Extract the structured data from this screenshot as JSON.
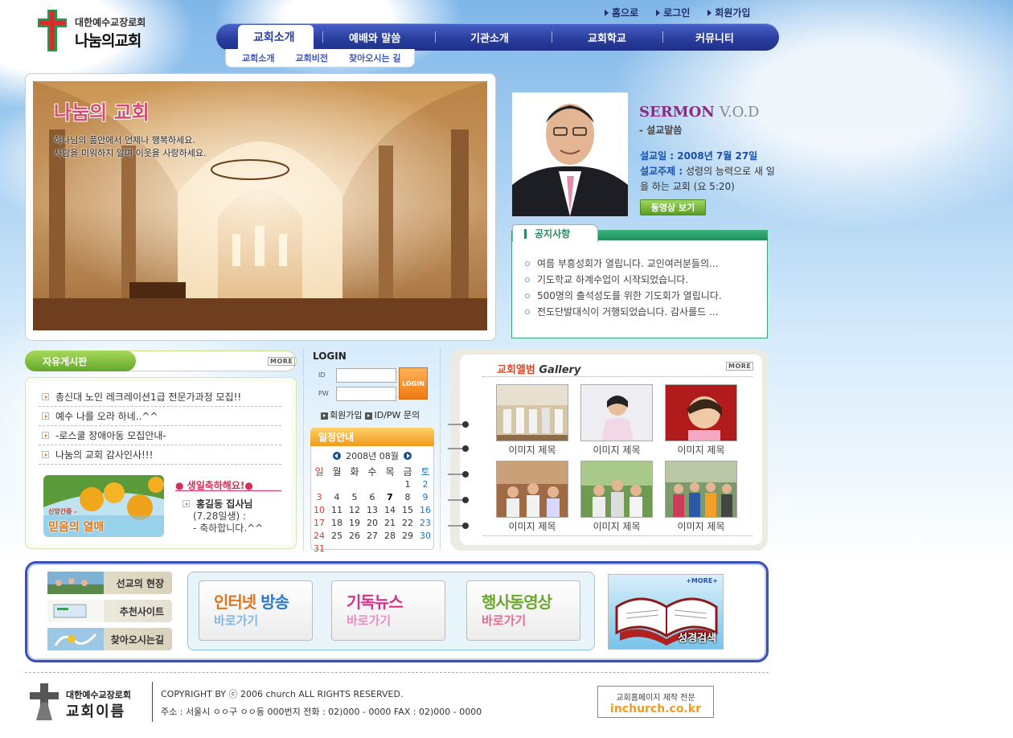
{
  "logo": {
    "org": "대한예수교장로회",
    "name": "나눔의교회"
  },
  "toplinks": [
    "홈으로",
    "로그인",
    "회원가입"
  ],
  "nav": {
    "items": [
      "교회소개",
      "예배와 말씀",
      "기관소개",
      "교회학교",
      "커뮤니티"
    ],
    "sub": [
      "교회소개",
      "교회비전",
      "찾아오시는 길"
    ]
  },
  "hero": {
    "title": "나눔의 교회",
    "line1": "하나님의 품안에서 언제나 행복하세요.",
    "line2": "사람을 미워하지 말며 이웃을 사랑하세요."
  },
  "sermon": {
    "title": "SERMON",
    "title2": "V.O.D",
    "subtitle": "- 설교말씀",
    "date_label": "설교일 :",
    "date": "2008년  7월  27일",
    "topic_label": "설교주제 :",
    "topic": "성령의 능력으로 새 일을 하는 교회 (요 5:20)",
    "button": "동영상 보기"
  },
  "notice": {
    "tab": "공지사항",
    "items": [
      "여름 부흥성회가 열립니다. 교인여러분들의...",
      "기도학교 하계수업이 시작되었습니다.",
      "500명의 출석성도를 위한 기도회가 열립니다.",
      "전도단발대식이 거행되었습니다. 감사를드 ..."
    ]
  },
  "board": {
    "title": "자유게시판",
    "more": "MORE",
    "items": [
      "총신대 노인 레크레이션1급 전문가과정 모집!!",
      "예수 나를 오라 하네..^^",
      "-로스쿨 장애아동 모집안내-",
      "나눔의 교회 감사인사!!!"
    ],
    "banner_small": "신앙간증 -",
    "banner_big": "믿음의 열매"
  },
  "birthday": {
    "title": "● 생일축하해요!●",
    "name": "홍길동 집사님",
    "date": "(7.28일생) :",
    "msg": "- 축하합니다.^^"
  },
  "login": {
    "title": "LOGIN",
    "id_label": "ID",
    "pw_label": "PW",
    "button": "LOGIN",
    "join": "회원가입",
    "find": "ID/PW 문의"
  },
  "calendar": {
    "title": "일정안내",
    "month": "2008년 08월",
    "dow": [
      "일",
      "월",
      "화",
      "수",
      "목",
      "금",
      "토"
    ],
    "days": [
      "",
      "",
      "",
      "",
      "",
      "1",
      "2",
      "3",
      "4",
      "5",
      "6",
      "7",
      "8",
      "9",
      "10",
      "11",
      "12",
      "13",
      "14",
      "15",
      "16",
      "17",
      "18",
      "19",
      "20",
      "21",
      "22",
      "23",
      "24",
      "25",
      "26",
      "27",
      "28",
      "29",
      "30",
      "31"
    ],
    "today": "7"
  },
  "gallery": {
    "title": "교회앨범",
    "title_en": "Gallery",
    "more": "MORE",
    "caption": "이미지 제목"
  },
  "quick": [
    "선교의 현장",
    "추천사이트",
    "찾아오시는길"
  ],
  "buttons": [
    {
      "t1a": "인터넷",
      "t1b": " 방송",
      "t2": "바로가기"
    },
    {
      "t1a": "기독뉴스",
      "t1b": "",
      "t2": "바로가기"
    },
    {
      "t1a": "행사동영상",
      "t1b": "",
      "t2": "바로가기"
    }
  ],
  "bible": {
    "more": "+MORE+",
    "label": "성경검색"
  },
  "footer": {
    "org": "대한예수교장로회",
    "name": "교회이름",
    "copy": "COPYRIGHT BY ⓒ 2006  church  ALL RIGHTS RESERVED.",
    "addr": "주소 :  서울시 ㅇㅇ구 ㅇㅇ동 000번지   전화 : 02)000 - 0000   FAX : 02)000 - 0000",
    "maker1": "교회홈페이지 제작 전문",
    "maker2": "inchurch.co.kr"
  },
  "colors": {
    "nav": "#2a3f9e",
    "accent_green": "#2b8a5a",
    "accent_orange": "#f09a1a",
    "frame_blue": "#3a4fb8"
  }
}
